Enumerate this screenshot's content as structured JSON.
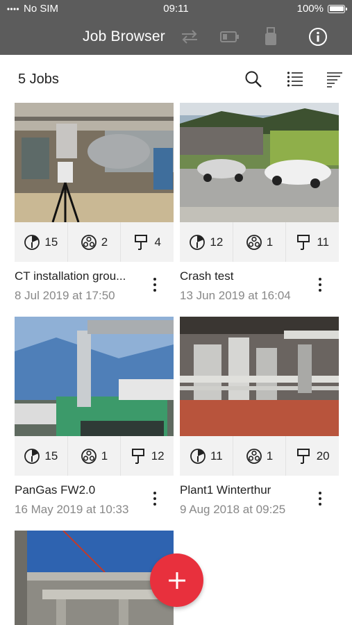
{
  "status_bar": {
    "carrier": "No SIM",
    "time": "09:11",
    "battery": "100%"
  },
  "nav": {
    "title": "Job Browser"
  },
  "header": {
    "jobs_count": "5 Jobs"
  },
  "jobs": [
    {
      "title": "CT installation grou...",
      "date": "8 Jul 2019 at 17:50",
      "scans": "15",
      "clusters": "2",
      "markers": "4"
    },
    {
      "title": "Crash test",
      "date": "13 Jun 2019 at 16:04",
      "scans": "12",
      "clusters": "1",
      "markers": "11"
    },
    {
      "title": "PanGas FW2.0",
      "date": "16 May 2019 at 10:33",
      "scans": "15",
      "clusters": "1",
      "markers": "12"
    },
    {
      "title": "Plant1 Winterthur",
      "date": "9 Aug 2018 at 09:25",
      "scans": "11",
      "clusters": "1",
      "markers": "20"
    }
  ],
  "icons": {
    "nav": [
      "sync-icon",
      "battery-icon",
      "usb-icon",
      "info-icon"
    ],
    "toolbar": [
      "search-icon",
      "list-view-icon",
      "sort-icon"
    ],
    "stats": [
      "scan-icon",
      "cluster-icon",
      "marker-icon"
    ]
  },
  "colors": {
    "nav_bar": "#5c5c5c",
    "fab": "#e8303d",
    "stats_bg": "#f2f2f2",
    "date_text": "#888888"
  }
}
